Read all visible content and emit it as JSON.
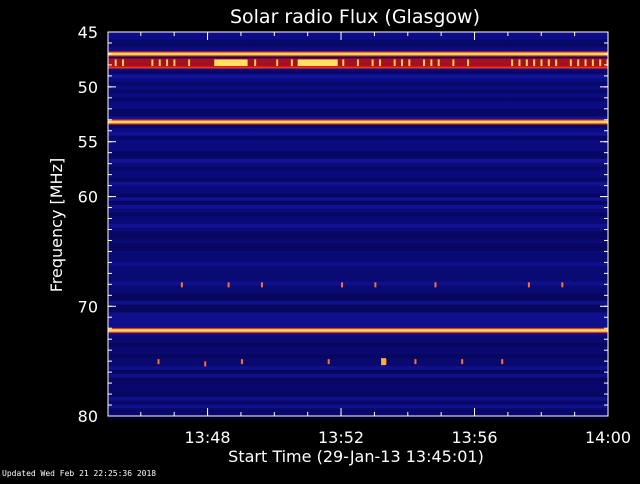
{
  "chart_data": {
    "type": "heatmap",
    "title": "Solar radio Flux (Glasgow)",
    "xlabel": "Start Time (29-Jan-13 13:45:01)",
    "ylabel": "Frequency [MHz]",
    "xlim_minutes": [
      45.0167,
      60
    ],
    "ylim": [
      45,
      80
    ],
    "x_ticks": [
      {
        "label": "13:48",
        "minute": 48
      },
      {
        "label": "13:52",
        "minute": 52
      },
      {
        "label": "13:56",
        "minute": 56
      },
      {
        "label": "14:00",
        "minute": 60
      }
    ],
    "y_ticks": [
      {
        "label": "45",
        "value": 45
      },
      {
        "label": "50",
        "value": 50
      },
      {
        "label": "55",
        "value": 55
      },
      {
        "label": "60",
        "value": 60
      },
      {
        "label": "70",
        "value": 70
      },
      {
        "label": "80",
        "value": 80
      }
    ],
    "colors": {
      "background": "#0a0a78",
      "band_dark": "#060650",
      "band_light": "#1a1ab0",
      "interference_line": "#ffe060",
      "line_edge": "#ff3010",
      "plot_border": "#ffffff"
    },
    "interference_lines_mhz": [
      47.0,
      53.2,
      72.2
    ],
    "strong_band_mhz": [
      47.4,
      48.2
    ]
  },
  "footer": {
    "updated_text": "Updated Wed Feb 21 22:25:36 2018"
  }
}
